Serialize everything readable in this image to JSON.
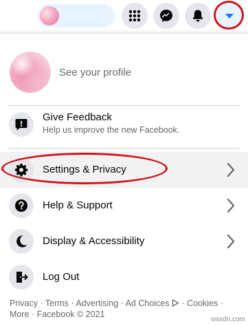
{
  "header": {
    "menu_icon": "grid-icon",
    "messenger_icon": "messenger-icon",
    "notifications_icon": "bell-icon",
    "account_icon": "caret-down-icon"
  },
  "profile": {
    "see_profile": "See your profile"
  },
  "menu": {
    "feedback": {
      "label": "Give Feedback",
      "sublabel": "Help us improve the new Facebook.",
      "icon": "exclamation-icon"
    },
    "settings": {
      "label": "Settings & Privacy",
      "icon": "gear-icon"
    },
    "help": {
      "label": "Help & Support",
      "icon": "question-icon"
    },
    "display": {
      "label": "Display & Accessibility",
      "icon": "moon-icon"
    },
    "logout": {
      "label": "Log Out",
      "icon": "logout-icon"
    }
  },
  "footer": {
    "privacy": "Privacy",
    "terms": "Terms",
    "advertising": "Advertising",
    "ad_choices": "Ad Choices",
    "cookies": "Cookies",
    "more": "More",
    "copyright": "Facebook © 2021",
    "separator": " · "
  },
  "watermark": "wsxdn.com",
  "colors": {
    "accent": "#1877f2",
    "annotation_red": "#d0141c",
    "icon_bg": "#e4e6eb"
  }
}
